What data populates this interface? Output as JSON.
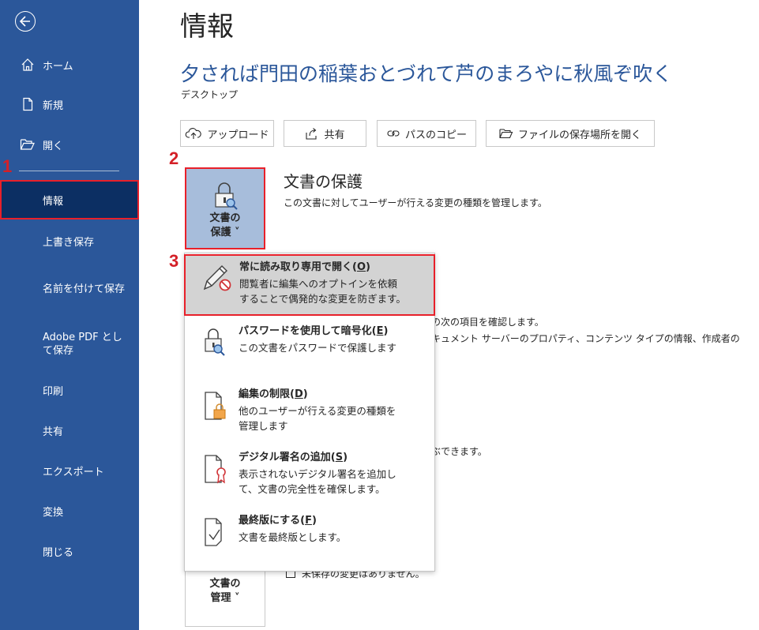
{
  "sidebar": {
    "items": [
      {
        "label": "ホーム"
      },
      {
        "label": "新規"
      },
      {
        "label": "開く"
      },
      {
        "label": "情報"
      },
      {
        "label": "上書き保存"
      },
      {
        "label": "名前を付けて保存"
      },
      {
        "label": "Adobe PDF として保存"
      },
      {
        "label": "印刷"
      },
      {
        "label": "共有"
      },
      {
        "label": "エクスポート"
      },
      {
        "label": "変換"
      },
      {
        "label": "閉じる"
      }
    ],
    "colors": {
      "background": "#2b579a",
      "active": "#0c2f63"
    }
  },
  "steps": [
    "1",
    "2",
    "3"
  ],
  "main": {
    "page_title": "情報",
    "doc_title": "夕されば門田の稲葉おとづれて芦のまろやに秋風ぞ吹く",
    "doc_location": "デスクトップ",
    "toolbar": {
      "upload": "アップロード",
      "share": "共有",
      "copy_path": "パスのコピー",
      "open_location": "ファイルの保存場所を開く"
    },
    "protect": {
      "button_line1": "文書の",
      "button_line2": "保護 ˅",
      "title": "文書の保護",
      "description": "この文書に対してユーザーが行える変更の種類を管理します。"
    },
    "background_text": {
      "inspect_line1": "の次の項目を確認します。",
      "inspect_line2": "キュメント サーバーのプロパティ、コンテンツ タイプの情報、作成者の",
      "versions_text": "ぶできます。",
      "unsaved_text": "未保存の変更はありません。"
    },
    "manage": {
      "button_line1": "文書の",
      "button_line2": "管理 ˅"
    }
  },
  "dropdown": {
    "items": [
      {
        "title": "常に読み取り専用で開く(",
        "key": "O",
        "close": ")",
        "desc1": "閲覧者に編集へのオプトインを依頼",
        "desc2": "することで偶発的な変更を防ぎます。",
        "icon": "pencil-no-icon"
      },
      {
        "title": "パスワードを使用して暗号化(",
        "key": "E",
        "close": ")",
        "desc1": "この文書をパスワードで保護します",
        "desc2": "",
        "icon": "lock-key-icon"
      },
      {
        "title": "編集の制限(",
        "key": "D",
        "close": ")",
        "desc1": "他のユーザーが行える変更の種類を",
        "desc2": "管理します",
        "icon": "doc-lock-icon"
      },
      {
        "title": "デジタル署名の追加(",
        "key": "S",
        "close": ")",
        "desc1": "表示されないデジタル署名を追加し",
        "desc2": "て、文書の完全性を確保します。",
        "icon": "doc-ribbon-icon"
      },
      {
        "title": "最終版にする(",
        "key": "F",
        "close": ")",
        "desc1": "文書を最終版とします。",
        "desc2": "",
        "icon": "doc-check-icon"
      }
    ]
  },
  "colors": {
    "accent": "#2b579a",
    "highlight_border": "#e8202a",
    "step_number": "#d42027"
  }
}
